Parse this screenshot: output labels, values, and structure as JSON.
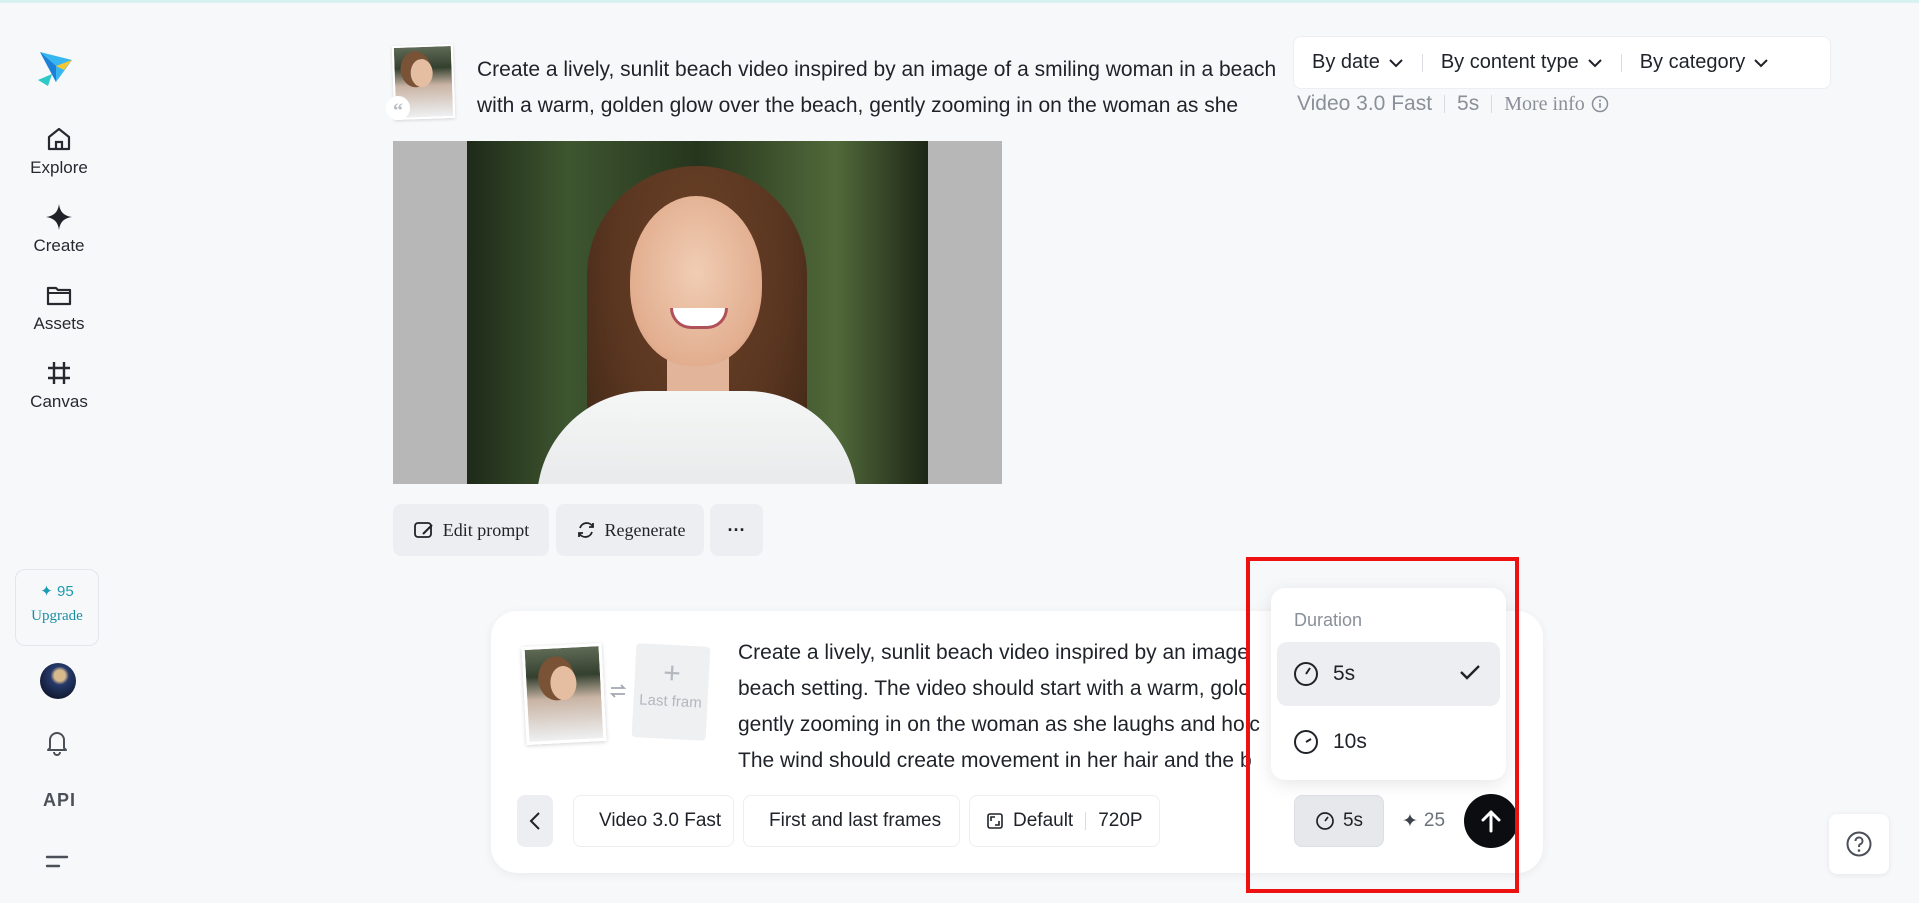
{
  "sidebar": {
    "items": [
      {
        "label": "Explore",
        "icon": "home-icon"
      },
      {
        "label": "Create",
        "icon": "sparkle-icon"
      },
      {
        "label": "Assets",
        "icon": "folder-icon"
      },
      {
        "label": "Canvas",
        "icon": "crop-icon"
      }
    ],
    "credits": "95",
    "upgrade_label": "Upgrade",
    "api_label": "API"
  },
  "filters": {
    "by_date": "By date",
    "by_content_type": "By content type",
    "by_category": "By category"
  },
  "generation": {
    "prompt_line1": "Create a lively, sunlit beach video inspired by an image of a smiling woman in a beach",
    "prompt_line2": "with a warm, golden glow over the beach, gently zooming in on the woman as she",
    "model": "Video 3.0 Fast",
    "duration": "5s",
    "more_info": "More info"
  },
  "actions": {
    "edit_prompt": "Edit prompt",
    "regenerate": "Regenerate",
    "more": "···"
  },
  "composer": {
    "last_frame_label": "Last fram",
    "prompt_lines": [
      "Create a lively, sunlit beach video inspired by an image",
      "beach setting. The video should start with a warm, golc",
      "gently zooming in on the woman as she laughs and holc",
      "The wind should create movement in her hair and the b"
    ],
    "model": "Video 3.0 Fast",
    "mode": "First and last frames",
    "ratio": "Default",
    "resolution": "720P",
    "duration": "5s",
    "cost": "25"
  },
  "duration_menu": {
    "title": "Duration",
    "options": [
      {
        "label": "5s",
        "selected": true
      },
      {
        "label": "10s",
        "selected": false
      }
    ]
  },
  "colors": {
    "accent": "#1a9cb0",
    "highlight": "#ee1111",
    "send_button": "#0b0d10"
  }
}
